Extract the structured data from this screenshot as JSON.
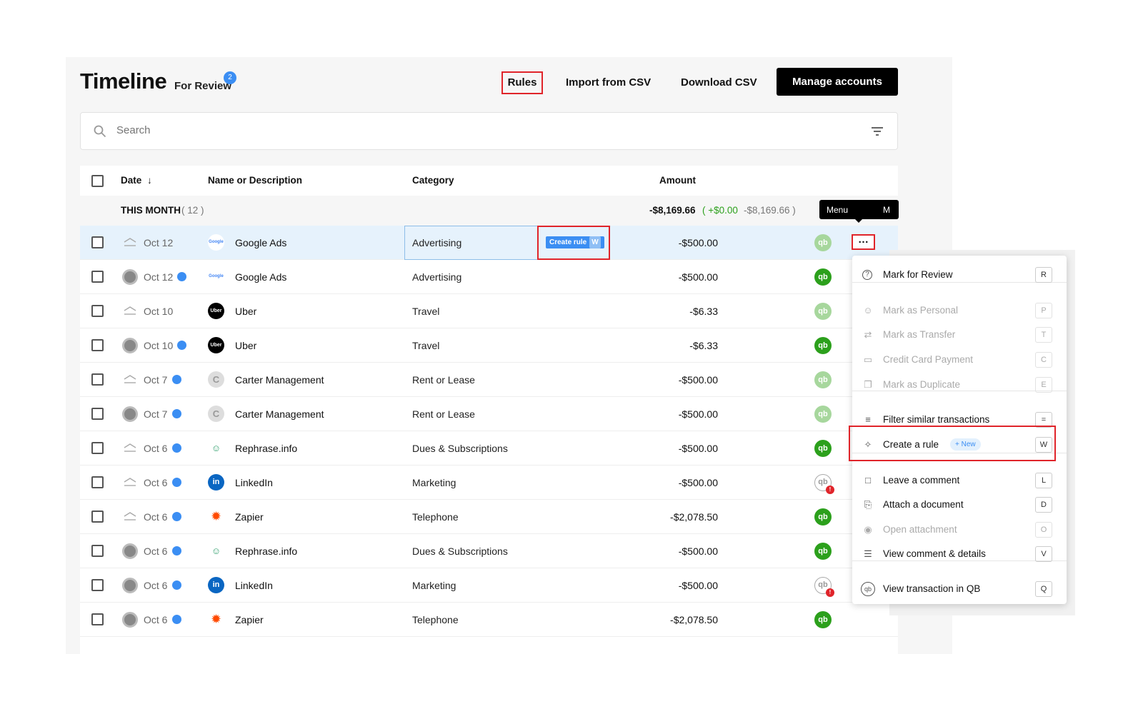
{
  "header": {
    "title": "Timeline",
    "for_review_label": "For Review",
    "for_review_count": "2",
    "rules_label": "Rules",
    "import_label": "Import from CSV",
    "download_label": "Download CSV",
    "manage_label": "Manage accounts"
  },
  "search": {
    "placeholder": "Search"
  },
  "table": {
    "columns": {
      "date": "Date",
      "name": "Name or Description",
      "category": "Category",
      "amount": "Amount"
    },
    "group": {
      "label": "THIS MONTH",
      "count": "( 12 )",
      "total": "-$8,169.66",
      "pos": "( +$0.00",
      "neg": "-$8,169.66 )"
    },
    "create_rule_chip": {
      "label": "Create rule",
      "key": "W"
    },
    "rows": [
      {
        "date": "Oct 12",
        "name": "Google Ads",
        "category": "Advertising",
        "amount": "-$500.00",
        "qb": "light",
        "source": "bank",
        "review": false,
        "logo": "google"
      },
      {
        "date": "Oct 12",
        "name": "Google Ads",
        "category": "Advertising",
        "amount": "-$500.00",
        "qb": "on",
        "source": "avatar",
        "review": true,
        "logo": "google"
      },
      {
        "date": "Oct 10",
        "name": "Uber",
        "category": "Travel",
        "amount": "-$6.33",
        "qb": "light",
        "source": "bank",
        "review": false,
        "logo": "uber"
      },
      {
        "date": "Oct 10",
        "name": "Uber",
        "category": "Travel",
        "amount": "-$6.33",
        "qb": "on",
        "source": "avatar",
        "review": true,
        "logo": "uber"
      },
      {
        "date": "Oct 7",
        "name": "Carter Management",
        "category": "Rent or Lease",
        "amount": "-$500.00",
        "qb": "light",
        "source": "bank",
        "review": true,
        "logo": "carter"
      },
      {
        "date": "Oct 7",
        "name": "Carter Management",
        "category": "Rent or Lease",
        "amount": "-$500.00",
        "qb": "light",
        "source": "avatar",
        "review": true,
        "logo": "carter"
      },
      {
        "date": "Oct 6",
        "name": "Rephrase.info",
        "category": "Dues & Subscriptions",
        "amount": "-$500.00",
        "qb": "on",
        "source": "bank",
        "review": true,
        "logo": "rephrase"
      },
      {
        "date": "Oct 6",
        "name": "LinkedIn",
        "category": "Marketing",
        "amount": "-$500.00",
        "qb": "off",
        "source": "bank",
        "review": true,
        "logo": "linkedin"
      },
      {
        "date": "Oct 6",
        "name": "Zapier",
        "category": "Telephone",
        "amount": "-$2,078.50",
        "qb": "on",
        "source": "bank",
        "review": true,
        "logo": "zapier"
      },
      {
        "date": "Oct 6",
        "name": "Rephrase.info",
        "category": "Dues & Subscriptions",
        "amount": "-$500.00",
        "qb": "on",
        "source": "avatar",
        "review": true,
        "logo": "rephrase"
      },
      {
        "date": "Oct 6",
        "name": "LinkedIn",
        "category": "Marketing",
        "amount": "-$500.00",
        "qb": "off",
        "source": "avatar",
        "review": true,
        "logo": "linkedin"
      },
      {
        "date": "Oct 6",
        "name": "Zapier",
        "category": "Telephone",
        "amount": "-$2,078.50",
        "qb": "on",
        "source": "avatar",
        "review": true,
        "logo": "zapier"
      }
    ]
  },
  "tooltip": {
    "label": "Menu",
    "key": "M"
  },
  "menu": {
    "items": [
      {
        "label": "Mark for Review",
        "key": "R",
        "icon": "question-icon",
        "glyph": "?",
        "disabled": false
      },
      {
        "label": "Mark as Personal",
        "key": "P",
        "icon": "person-icon",
        "glyph": "☺",
        "disabled": true
      },
      {
        "label": "Mark as Transfer",
        "key": "T",
        "icon": "transfer-icon",
        "glyph": "⇄",
        "disabled": true
      },
      {
        "label": "Credit Card Payment",
        "key": "C",
        "icon": "card-icon",
        "glyph": "▭",
        "disabled": true
      },
      {
        "label": "Mark as Duplicate",
        "key": "E",
        "icon": "duplicate-icon",
        "glyph": "❐",
        "disabled": true
      },
      {
        "label": "Filter similar transactions",
        "key": "=",
        "icon": "filter-icon",
        "glyph": "≡",
        "disabled": false
      },
      {
        "label": "Create a rule",
        "key": "W",
        "icon": "magic-wand-icon",
        "glyph": "✧",
        "disabled": false,
        "badge": "+ New"
      },
      {
        "label": "Leave a comment",
        "key": "L",
        "icon": "comment-icon",
        "glyph": "□",
        "disabled": false
      },
      {
        "label": "Attach a document",
        "key": "D",
        "icon": "paperclip-icon",
        "glyph": "⎘",
        "disabled": false
      },
      {
        "label": "Open attachment",
        "key": "O",
        "icon": "eye-icon",
        "glyph": "◉",
        "disabled": true
      },
      {
        "label": "View comment & details",
        "key": "V",
        "icon": "list-icon",
        "glyph": "☰",
        "disabled": false
      },
      {
        "label": "View transaction in QB",
        "key": "Q",
        "icon": "quickbooks-icon",
        "glyph": "qb",
        "disabled": false
      }
    ]
  },
  "colors": {
    "accent": "#3b8ef3",
    "highlight": "#e0242a",
    "qb_green": "#2ca01c",
    "qb_light": "#a7d79d"
  }
}
